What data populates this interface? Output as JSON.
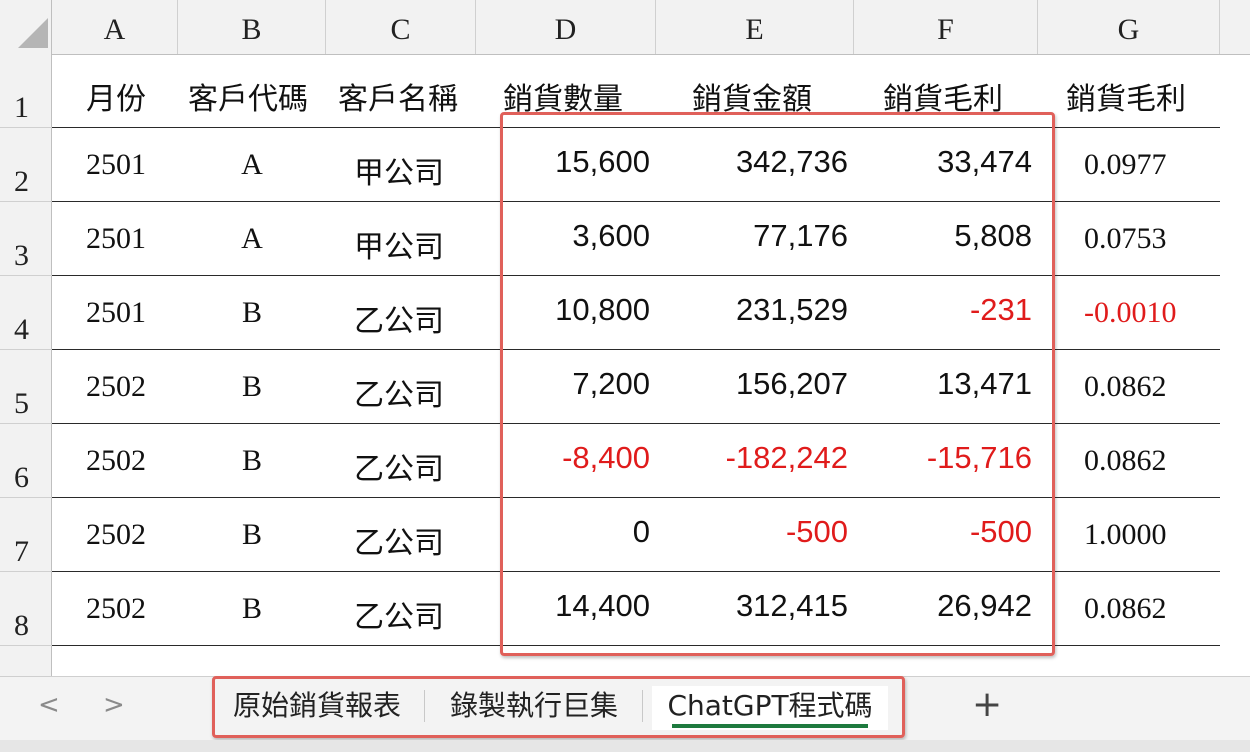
{
  "columns": [
    "A",
    "B",
    "C",
    "D",
    "E",
    "F",
    "G"
  ],
  "rows": [
    "1",
    "2",
    "3",
    "4",
    "5",
    "6",
    "7",
    "8"
  ],
  "headers": [
    "月份",
    "客戶代碼",
    "客戶名稱",
    "銷貨數量",
    "銷貨金額",
    "銷貨毛利",
    "銷貨毛利"
  ],
  "data": [
    [
      "2501",
      "A",
      "甲公司",
      "15,600",
      "342,736",
      "33,474",
      "0.0977"
    ],
    [
      "2501",
      "A",
      "甲公司",
      "3,600",
      "77,176",
      "5,808",
      "0.0753"
    ],
    [
      "2501",
      "B",
      "乙公司",
      "10,800",
      "231,529",
      "-231",
      "-0.0010"
    ],
    [
      "2502",
      "B",
      "乙公司",
      "7,200",
      "156,207",
      "13,471",
      "0.0862"
    ],
    [
      "2502",
      "B",
      "乙公司",
      "-8,400",
      "-182,242",
      "-15,716",
      "0.0862"
    ],
    [
      "2502",
      "B",
      "乙公司",
      "0",
      "-500",
      "-500",
      "1.0000"
    ],
    [
      "2502",
      "B",
      "乙公司",
      "14,400",
      "312,415",
      "26,942",
      "0.0862"
    ]
  ],
  "colors": {
    "negative": "#e01b1b",
    "highlight_border": "#e0605a",
    "active_tab_underline": "#1e7a3e"
  },
  "nav": {
    "prev_icon": "chevron-left-icon",
    "prev_glyph": "<",
    "next_icon": "chevron-right-icon",
    "next_glyph": ">"
  },
  "tabs": [
    "原始銷貨報表",
    "錄製執行巨集",
    "ChatGPT程式碼"
  ],
  "active_tab": 2,
  "add_sheet": {
    "icon": "plus-icon",
    "glyph": "+"
  }
}
